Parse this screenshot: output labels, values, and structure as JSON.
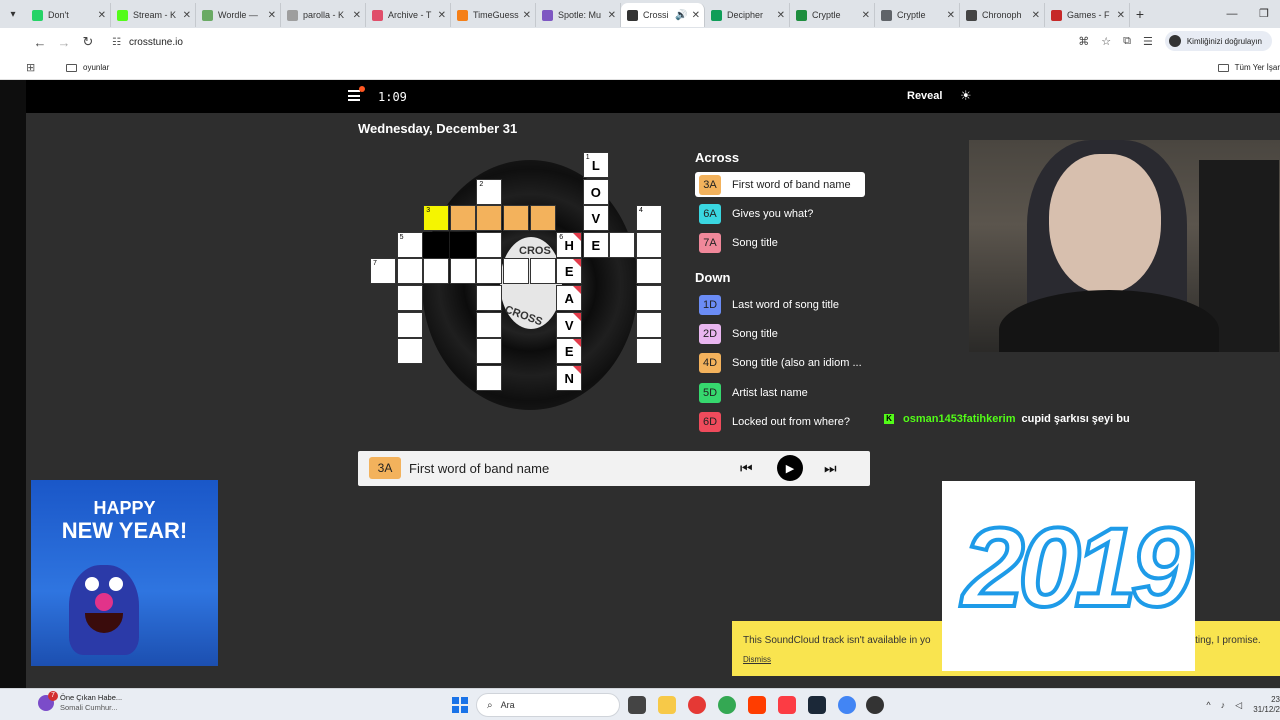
{
  "browser": {
    "tabs": [
      {
        "title": "Don't",
        "color": "#25d366"
      },
      {
        "title": "Stream - K",
        "color": "#53fc18"
      },
      {
        "title": "Wordle —",
        "color": "#6aaa64"
      },
      {
        "title": "parolla - K",
        "color": "#9e9e9e"
      },
      {
        "title": "Archive - T",
        "color": "#e04e6a"
      },
      {
        "title": "TimeGuess",
        "color": "#f57f17"
      },
      {
        "title": "Spotle: Mu",
        "color": "#7e57c2"
      },
      {
        "title": "Crossi",
        "color": "#333333",
        "active": true
      },
      {
        "title": "Decipher",
        "color": "#0f9d58"
      },
      {
        "title": "Cryptle",
        "color": "#1e8e3e"
      },
      {
        "title": "Cryptle",
        "color": "#5f6368"
      },
      {
        "title": "Chronoph",
        "color": "#444444"
      },
      {
        "title": "Games - F",
        "color": "#c62828"
      }
    ],
    "url": "crosstune.io",
    "profile_label": "Kimliğinizi doğrulayın",
    "bookmark_folder": "oyunlar",
    "bookmark_right": "Tüm Yer İşar"
  },
  "site": {
    "timer": "1:09",
    "reveal_label": "Reveal",
    "date": "Wednesday, December 31",
    "record_label_top": "CROS",
    "record_label_bottom": "CROSS"
  },
  "grid": {
    "cells": [
      {
        "r": 0,
        "c": 8,
        "num": "1",
        "letter": "L"
      },
      {
        "r": 1,
        "c": 8,
        "letter": "O"
      },
      {
        "r": 2,
        "c": 8,
        "letter": "V"
      },
      {
        "r": 3,
        "c": 8,
        "letter": "E"
      },
      {
        "r": 1,
        "c": 4,
        "num": "2"
      },
      {
        "r": 2,
        "c": 4,
        "state": "orange"
      },
      {
        "r": 2,
        "c": 2,
        "num": "3",
        "state": "yellow"
      },
      {
        "r": 2,
        "c": 3,
        "state": "orange"
      },
      {
        "r": 2,
        "c": 5,
        "state": "orange"
      },
      {
        "r": 2,
        "c": 6,
        "state": "orange"
      },
      {
        "r": 2,
        "c": 10,
        "num": "4"
      },
      {
        "r": 3,
        "c": 1,
        "num": "5"
      },
      {
        "r": 3,
        "c": 2,
        "state": "black"
      },
      {
        "r": 3,
        "c": 3,
        "state": "black"
      },
      {
        "r": 3,
        "c": 4
      },
      {
        "r": 3,
        "c": 7,
        "num": "6",
        "letter": "H",
        "flag": true
      },
      {
        "r": 3,
        "c": 9
      },
      {
        "r": 3,
        "c": 10
      },
      {
        "r": 4,
        "c": 0,
        "num": "7"
      },
      {
        "r": 4,
        "c": 1
      },
      {
        "r": 4,
        "c": 2
      },
      {
        "r": 4,
        "c": 3
      },
      {
        "r": 4,
        "c": 4
      },
      {
        "r": 4,
        "c": 5
      },
      {
        "r": 4,
        "c": 6
      },
      {
        "r": 4,
        "c": 7,
        "letter": "E",
        "flag": true
      },
      {
        "r": 4,
        "c": 10
      },
      {
        "r": 5,
        "c": 1
      },
      {
        "r": 5,
        "c": 4
      },
      {
        "r": 5,
        "c": 7,
        "letter": "A",
        "flag": true
      },
      {
        "r": 5,
        "c": 10
      },
      {
        "r": 6,
        "c": 1
      },
      {
        "r": 6,
        "c": 4
      },
      {
        "r": 6,
        "c": 7,
        "letter": "V",
        "flag": true
      },
      {
        "r": 6,
        "c": 10
      },
      {
        "r": 7,
        "c": 1
      },
      {
        "r": 7,
        "c": 4
      },
      {
        "r": 7,
        "c": 7,
        "letter": "E",
        "flag": true
      },
      {
        "r": 7,
        "c": 10
      },
      {
        "r": 8,
        "c": 4
      },
      {
        "r": 8,
        "c": 7,
        "letter": "N",
        "flag": true
      }
    ]
  },
  "clues": {
    "across_title": "Across",
    "down_title": "Down",
    "across": [
      {
        "id": "3A",
        "text": "First word of band name",
        "color": "#f3b25c",
        "active": true
      },
      {
        "id": "6A",
        "text": "Gives you what?",
        "color": "#3ad6e0"
      },
      {
        "id": "7A",
        "text": "Song title",
        "color": "#f0889a"
      }
    ],
    "down": [
      {
        "id": "1D",
        "text": "Last word of song title",
        "color": "#6b8cf5"
      },
      {
        "id": "2D",
        "text": "Song title",
        "color": "#e9b6f0"
      },
      {
        "id": "4D",
        "text": "Song title (also an idiom ...",
        "color": "#f3b25c"
      },
      {
        "id": "5D",
        "text": "Artist last name",
        "color": "#36d86e"
      },
      {
        "id": "6D",
        "text": "Locked out from where?",
        "color": "#ef4b5c"
      }
    ]
  },
  "player": {
    "clue_id": "3A",
    "clue_text": "First word of band name"
  },
  "chat": {
    "username": "osman1453fatihkerim",
    "message": "cupid şarkısı şeyi bu"
  },
  "overlays": {
    "gif_left_line1": "HAPPY",
    "gif_left_line2": "NEW YEAR!",
    "gif_right_text": "2019"
  },
  "toast": {
    "message": "This SoundCloud track isn't available in yo",
    "message_tail": "eating, I promise.",
    "dismiss": "Dismiss"
  },
  "taskbar": {
    "news_badge": "7",
    "news_title": "Öne Çıkan Habe...",
    "news_sub": "Somali Cumhur...",
    "search_placeholder": "Ara",
    "clock_time": "23",
    "clock_date": "31/12/2"
  }
}
